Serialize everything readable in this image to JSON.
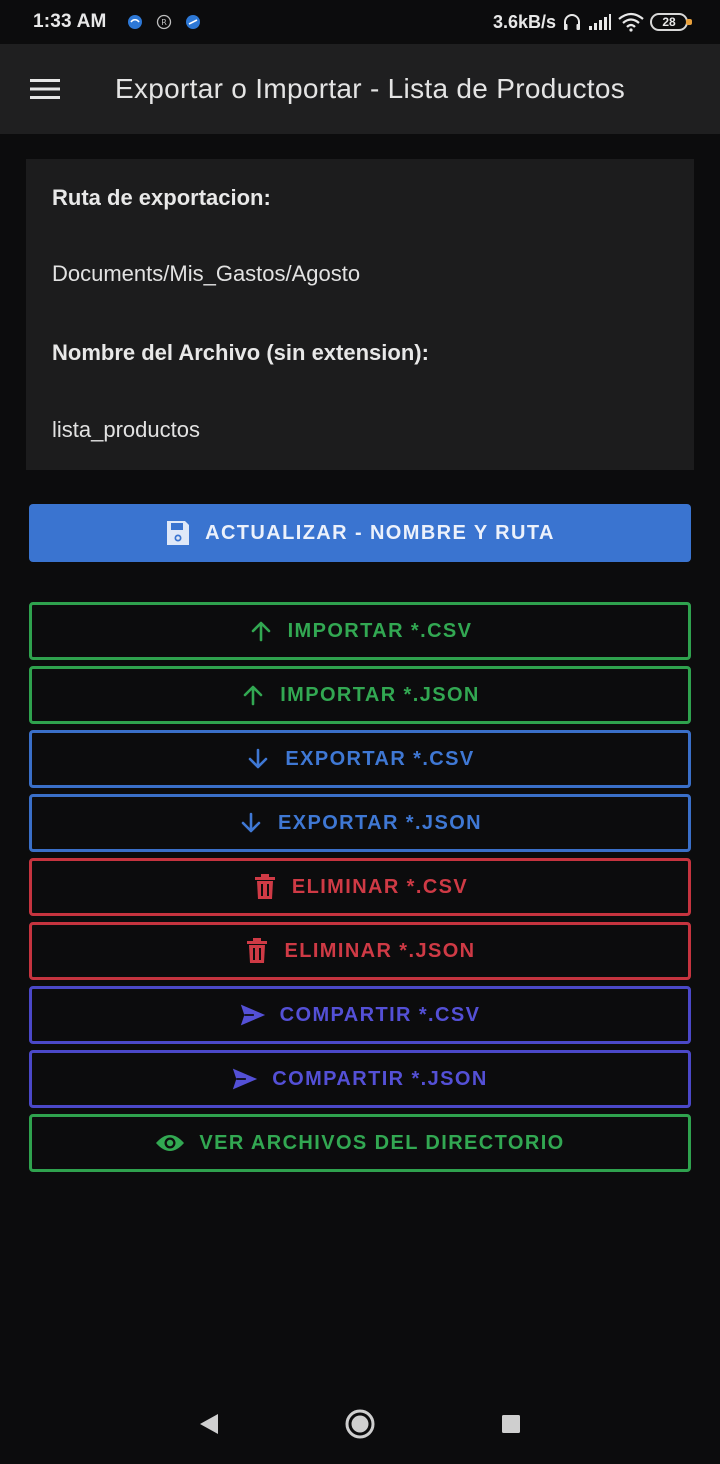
{
  "status_bar": {
    "time": "1:33 AM",
    "network_speed": "3.6kB/s",
    "battery": "28",
    "icons": [
      "notification-icon",
      "notification-icon",
      "notification-icon",
      "headphones-icon",
      "signal-icon",
      "wifi-icon",
      "battery-icon"
    ]
  },
  "app_bar": {
    "title": "Exportar o Importar - Lista de Productos",
    "menu_icon": "hamburger-menu-icon"
  },
  "info": {
    "path_label": "Ruta de exportacion:",
    "path_value": "Documents/Mis_Gastos/Agosto",
    "filename_label": "Nombre del Archivo (sin extension):",
    "filename_value": "lista_productos"
  },
  "actions": {
    "update_label": "ACTUALIZAR - NOMBRE Y RUTA",
    "import_csv": "IMPORTAR *.CSV",
    "import_json": "IMPORTAR *.JSON",
    "export_csv": "EXPORTAR *.CSV",
    "export_json": "EXPORTAR *.JSON",
    "delete_csv": "ELIMINAR *.CSV",
    "delete_json": "ELIMINAR *.JSON",
    "share_csv": "COMPARTIR *.CSV",
    "share_json": "COMPARTIR *.JSON",
    "view_files": "VER ARCHIVOS DEL DIRECTORIO"
  },
  "colors": {
    "background": "#0c0c0d",
    "app_bar": "#1f1f20",
    "primary": "#3a74d0",
    "green": "#32a852",
    "blue": "#3f78d4",
    "red": "#cf3a45",
    "indigo": "#5450d6"
  }
}
